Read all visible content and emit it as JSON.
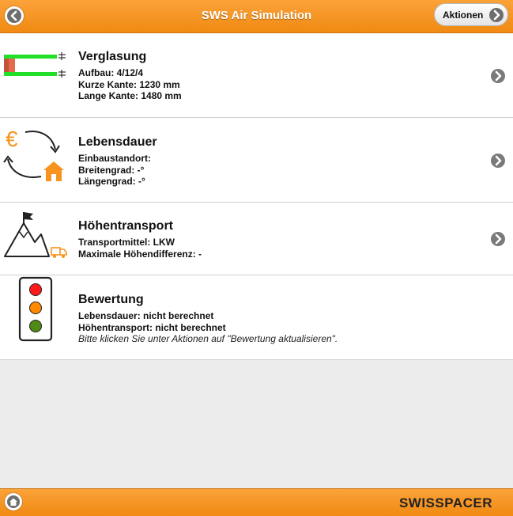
{
  "header": {
    "title": "SWS Air Simulation",
    "actions_label": "Aktionen"
  },
  "rows": [
    {
      "icon": "glazing-icon",
      "title": "Verglasung",
      "lines": [
        "Aufbau: 4/12/4",
        "Kurze Kante: 1230 mm",
        "Lange Kante: 1480 mm"
      ]
    },
    {
      "icon": "lifecycle-icon",
      "title": "Lebensdauer",
      "lines": [
        "Einbaustandort:",
        "Breitengrad: -°",
        "Längengrad: -°"
      ]
    },
    {
      "icon": "mountain-transport-icon",
      "title": "Höhentransport",
      "lines": [
        "Transportmittel: LKW",
        "Maximale Höhendifferenz: -"
      ]
    },
    {
      "icon": "traffic-light-icon",
      "title": "Bewertung",
      "lines": [
        "Lebensdauer: nicht berechnet",
        "Höhentransport: nicht berechnet"
      ],
      "note": "Bitte klicken Sie unter Aktionen auf \"Bewertung aktualisieren\"."
    }
  ],
  "footer": {
    "brand": "SWISSPACER"
  },
  "colors": {
    "accent": "#f7931e",
    "glazing_green": "#22e02a",
    "traffic_red": "#ff1a1a",
    "traffic_orange": "#ff8a00",
    "traffic_green": "#4e8a14"
  }
}
